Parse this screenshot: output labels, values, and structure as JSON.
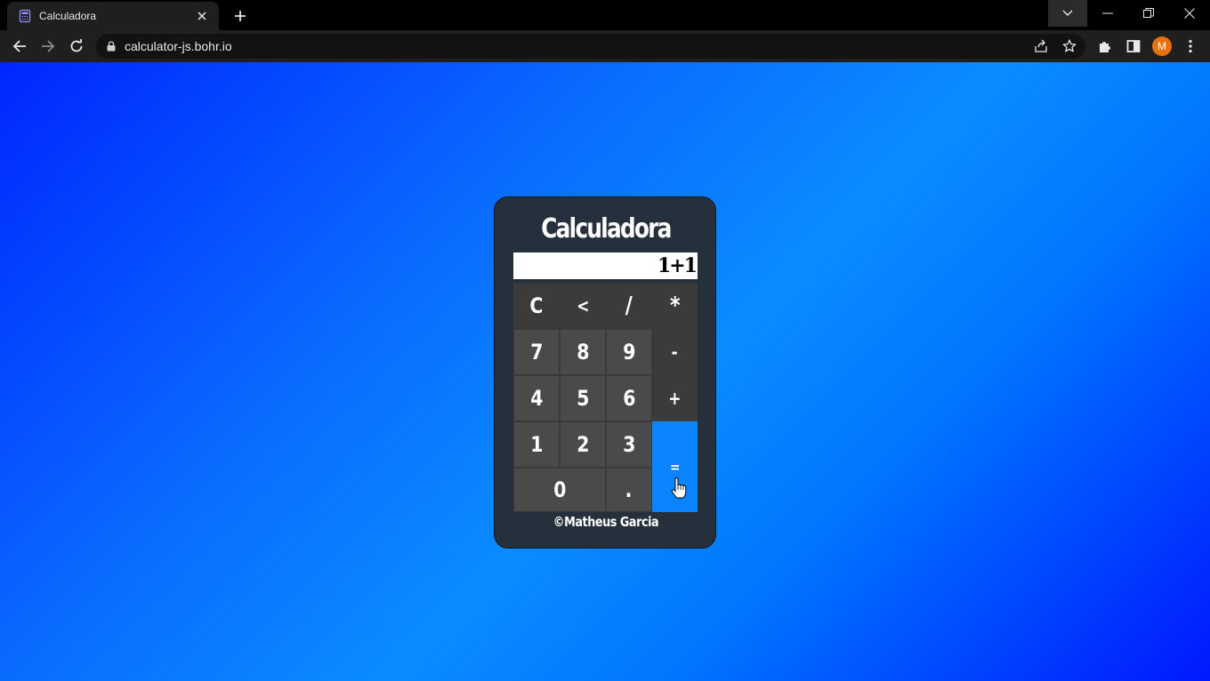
{
  "browser": {
    "tab_title": "Calculadora",
    "url": "calculator-js.bohr.io",
    "profile_initial": "M",
    "profile_color": "#e8710a",
    "favicon_icon": "calculator-icon"
  },
  "calculator": {
    "title": "Calculadora",
    "display_value": "1+1",
    "keys": {
      "clear": "C",
      "backspace": "<",
      "divide": "/",
      "multiply": "*",
      "seven": "7",
      "eight": "8",
      "nine": "9",
      "subtract": "-",
      "four": "4",
      "five": "5",
      "six": "6",
      "add": "+",
      "one": "1",
      "two": "2",
      "three": "3",
      "equals": "=",
      "zero": "0",
      "decimal": "."
    },
    "credit": "©Matheus Garcia",
    "colors": {
      "panel": "#26303d",
      "key": "#4a4a4a",
      "operator_key": "#3b3b3b",
      "equals_key": "#0a84ff"
    }
  }
}
